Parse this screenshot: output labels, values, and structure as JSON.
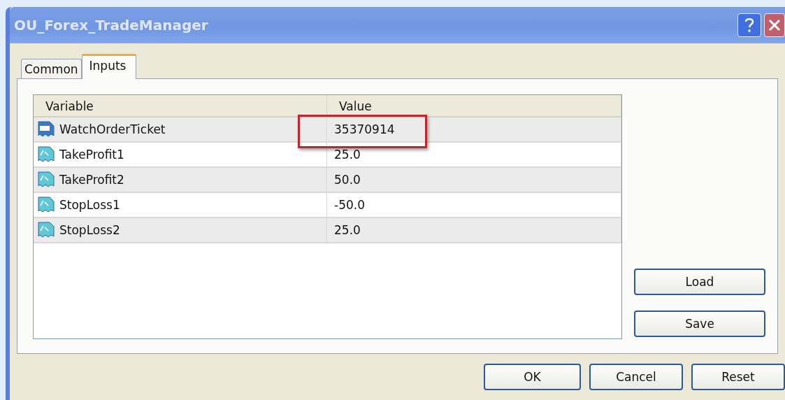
{
  "window": {
    "title": "OU_Forex_TradeManager"
  },
  "title_buttons": [
    {
      "kind": "help"
    },
    {
      "kind": "close"
    }
  ],
  "tabs": [
    {
      "label": "Common",
      "selected": false
    },
    {
      "label": "Inputs",
      "selected": true
    }
  ],
  "table": {
    "columns": [
      "Variable",
      "Value"
    ],
    "rows": [
      {
        "kind": "integer",
        "variable": "WatchOrderTicket",
        "value": "35370914",
        "highlighted": true
      },
      {
        "kind": "double",
        "variable": "TakeProfit1",
        "value": "25.0",
        "highlighted": false
      },
      {
        "kind": "double",
        "variable": "TakeProfit2",
        "value": "50.0",
        "highlighted": false
      },
      {
        "kind": "double",
        "variable": "StopLoss1",
        "value": "-50.0",
        "highlighted": false
      },
      {
        "kind": "double",
        "variable": "StopLoss2",
        "value": "25.0",
        "highlighted": false
      }
    ]
  },
  "side_buttons": [
    "Load",
    "Save"
  ],
  "buttons": [
    "OK",
    "Cancel",
    "Reset"
  ]
}
